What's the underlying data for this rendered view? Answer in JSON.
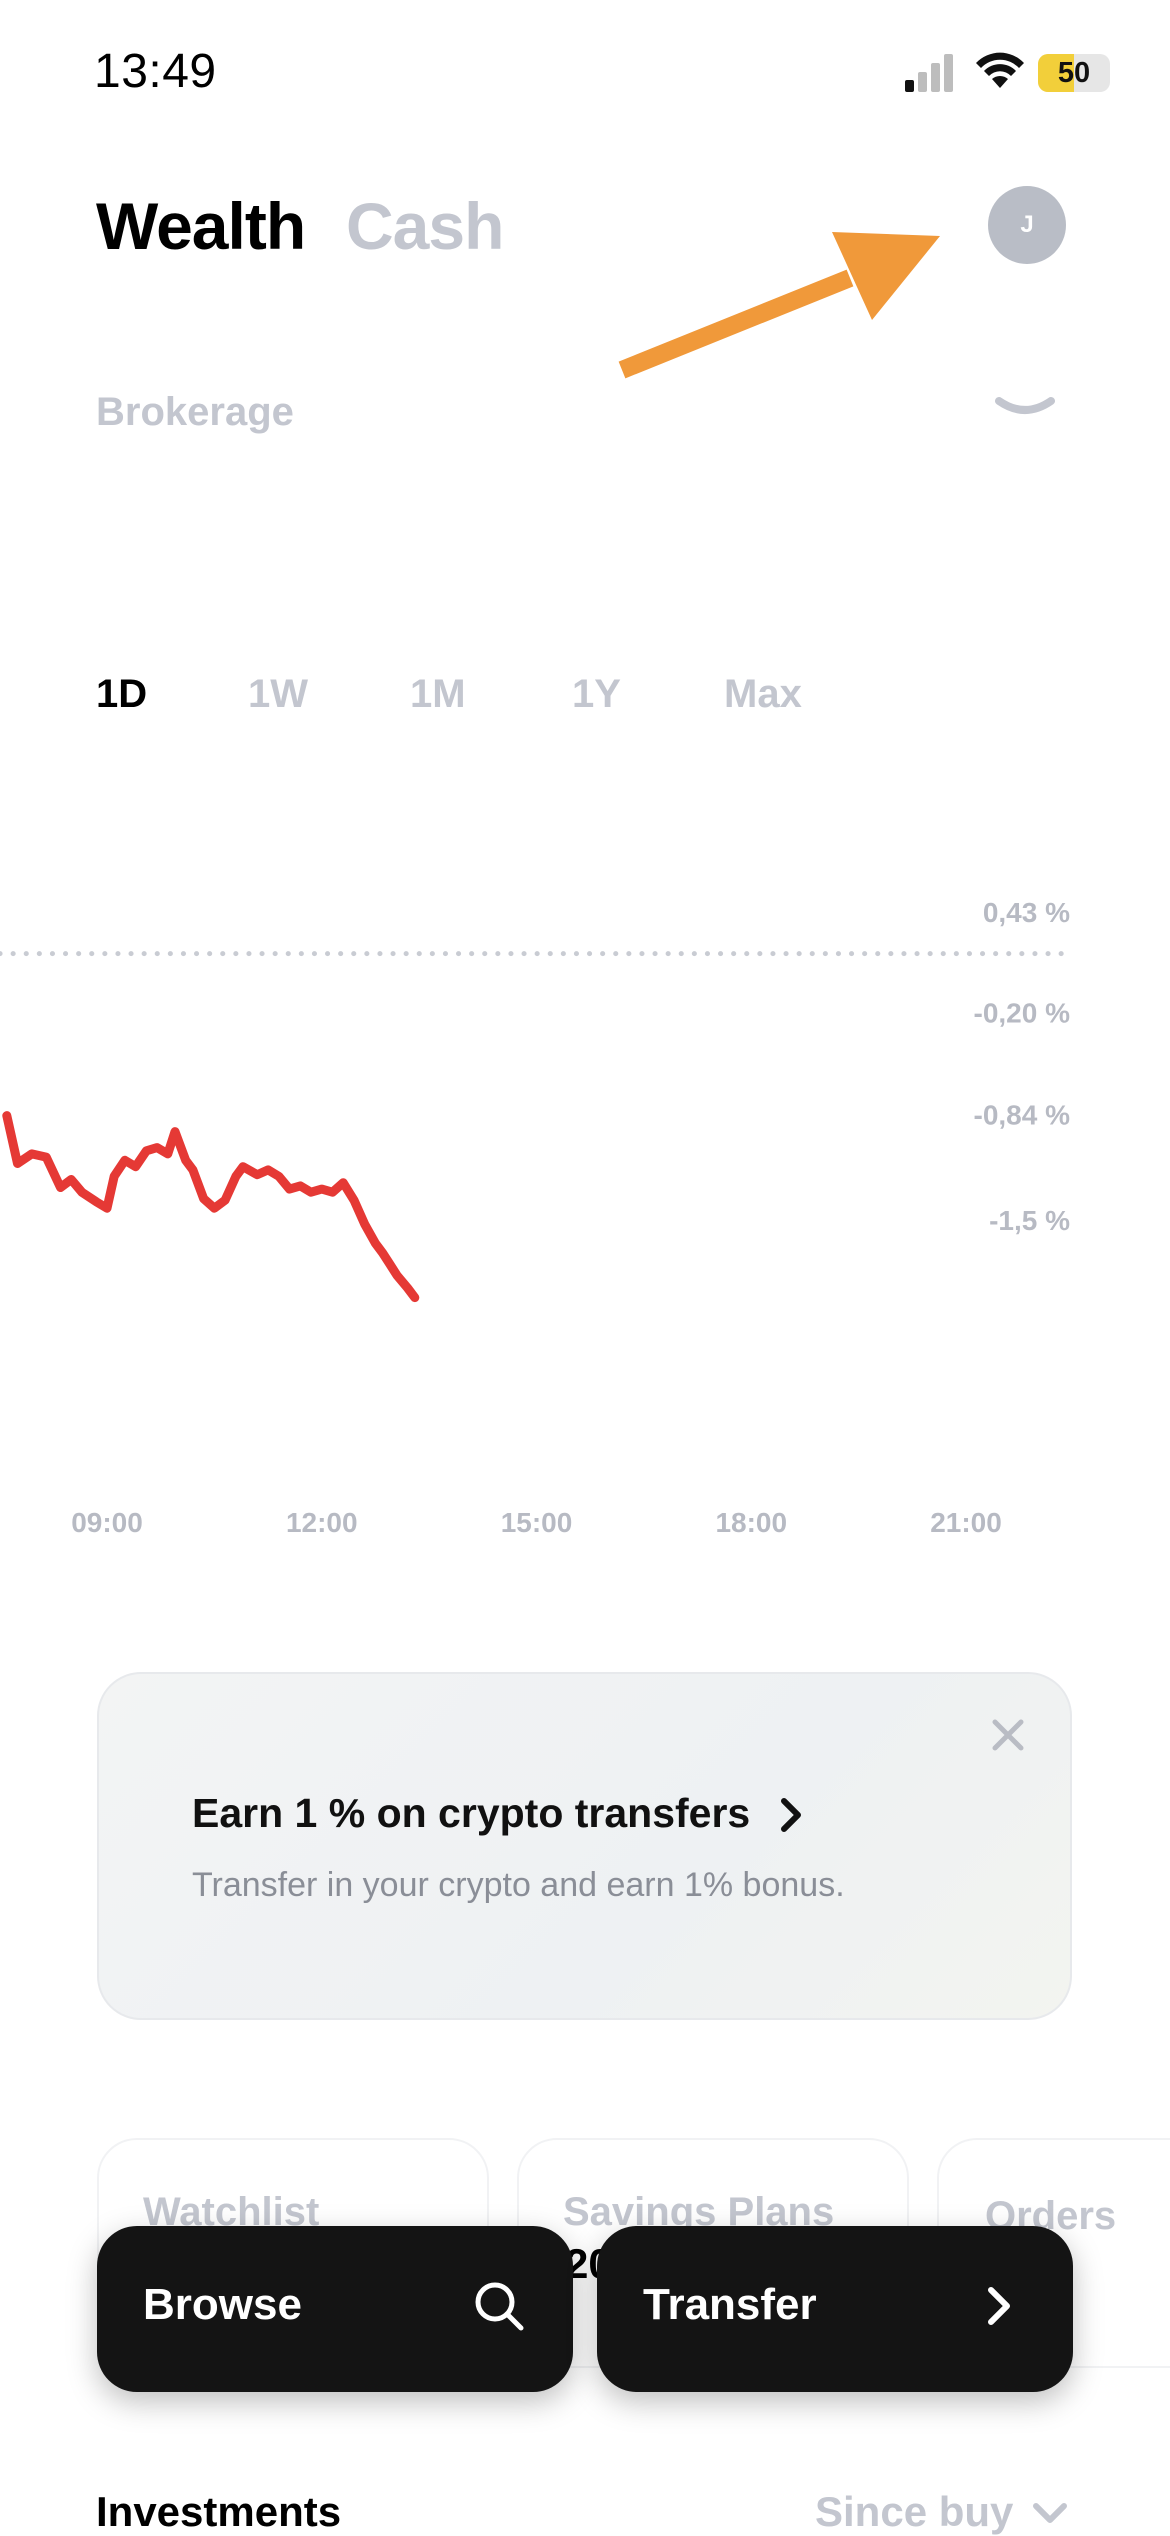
{
  "status_bar": {
    "time": "13:49",
    "battery": "50",
    "battery_level": 0.5,
    "signal_icon": "cell-signal-icon",
    "wifi_icon": "wifi-icon"
  },
  "header": {
    "tabs": [
      "Wealth",
      "Cash"
    ],
    "active_tab": "Wealth",
    "avatar_initial": "J"
  },
  "account": {
    "name": "Brokerage"
  },
  "timeframes": [
    "1D",
    "1W",
    "1M",
    "1Y",
    "Max"
  ],
  "active_timeframe": "1D",
  "chart_data": {
    "type": "line",
    "y_ticks": [
      "0,43 %",
      "-0,20 %",
      "-0,84 %",
      "-1,5 %"
    ],
    "y_tick_values": [
      0.43,
      -0.2,
      -0.84,
      -1.5
    ],
    "baseline": 0.0,
    "x_ticks": [
      "09:00",
      "12:00",
      "15:00",
      "18:00",
      "21:00"
    ],
    "x_hours": [
      9,
      12,
      15,
      18,
      21
    ],
    "series": [
      {
        "color": "#e53935",
        "x": [
          7.6,
          7.75,
          7.95,
          8.15,
          8.35,
          8.5,
          8.65,
          8.85,
          9.0,
          9.1,
          9.25,
          9.4,
          9.55,
          9.7,
          9.85,
          9.95,
          10.1,
          10.2,
          10.35,
          10.5,
          10.65,
          10.8,
          10.9,
          11.1,
          11.25,
          11.4,
          11.55,
          11.7,
          11.85,
          12.0,
          12.15,
          12.3,
          12.45,
          12.6,
          12.75,
          12.85,
          12.95,
          13.05,
          13.2,
          13.3
        ],
        "y": [
          -0.42,
          -0.72,
          -0.66,
          -0.68,
          -0.87,
          -0.82,
          -0.9,
          -0.96,
          -1.0,
          -0.8,
          -0.7,
          -0.74,
          -0.64,
          -0.62,
          -0.66,
          -0.52,
          -0.7,
          -0.76,
          -0.94,
          -1.0,
          -0.95,
          -0.8,
          -0.74,
          -0.79,
          -0.76,
          -0.8,
          -0.88,
          -0.86,
          -0.9,
          -0.88,
          -0.9,
          -0.84,
          -0.95,
          -1.1,
          -1.22,
          -1.28,
          -1.35,
          -1.42,
          -1.5,
          -1.56
        ]
      }
    ]
  },
  "promo": {
    "title": "Earn 1 % on crypto transfers",
    "subtitle": "Transfer in your crypto and earn 1% bonus."
  },
  "shortcuts": [
    "Watchlist",
    "Savings Plans",
    "Orders"
  ],
  "partial_text": "20",
  "actions": {
    "browse": "Browse",
    "transfer": "Transfer"
  },
  "investments": {
    "title": "Investments",
    "sort": "Since buy"
  },
  "colors": {
    "accent_arrow": "#f0993a",
    "line_negative": "#e53935",
    "muted": "#c3c6cf"
  }
}
